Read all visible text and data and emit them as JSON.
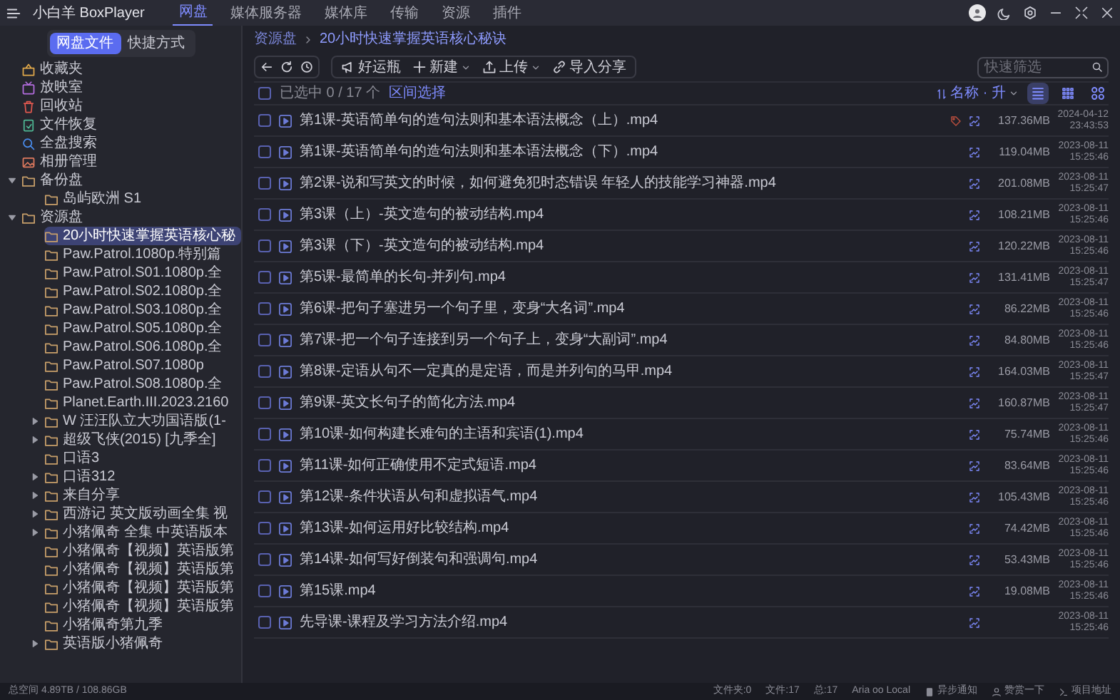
{
  "app": {
    "title": "小白羊 BoxPlayer"
  },
  "nav_tabs": [
    {
      "label": "网盘",
      "selected": true
    },
    {
      "label": "媒体服务器",
      "selected": false
    },
    {
      "label": "媒体库",
      "selected": false
    },
    {
      "label": "传输",
      "selected": false
    },
    {
      "label": "资源",
      "selected": false
    },
    {
      "label": "插件",
      "selected": false
    }
  ],
  "sidebar": {
    "tabs": [
      {
        "label": "网盘文件",
        "selected": true
      },
      {
        "label": "快捷方式",
        "selected": false
      }
    ],
    "tree": [
      {
        "label": "收藏夹",
        "kind": "favorites",
        "selected": false
      },
      {
        "label": "放映室",
        "kind": "screening",
        "selected": false
      },
      {
        "label": "回收站",
        "kind": "trash",
        "selected": false
      },
      {
        "label": "文件恢复",
        "kind": "recover",
        "selected": false
      },
      {
        "label": "全盘搜索",
        "kind": "search",
        "selected": false
      },
      {
        "label": "相册管理",
        "kind": "album",
        "selected": false
      },
      {
        "label": "备份盘",
        "kind": "folder",
        "expanded": true,
        "selected": false,
        "children": [
          {
            "label": "岛屿欧洲 S1",
            "kind": "folder",
            "selected": false
          }
        ]
      },
      {
        "label": "资源盘",
        "kind": "folder",
        "expanded": true,
        "selected": false,
        "children": [
          {
            "label": "20小时快速掌握英语核心秘",
            "kind": "folder",
            "selected": true
          },
          {
            "label": "Paw.Patrol.1080p.特别篇",
            "kind": "folder",
            "selected": false
          },
          {
            "label": "Paw.Patrol.S01.1080p.全",
            "kind": "folder",
            "selected": false
          },
          {
            "label": "Paw.Patrol.S02.1080p.全",
            "kind": "folder",
            "selected": false
          },
          {
            "label": "Paw.Patrol.S03.1080p.全",
            "kind": "folder",
            "selected": false
          },
          {
            "label": "Paw.Patrol.S05.1080p.全",
            "kind": "folder",
            "selected": false
          },
          {
            "label": "Paw.Patrol.S06.1080p.全",
            "kind": "folder",
            "selected": false
          },
          {
            "label": "Paw.Patrol.S07.1080p",
            "kind": "folder",
            "selected": false
          },
          {
            "label": "Paw.Patrol.S08.1080p.全",
            "kind": "folder",
            "selected": false
          },
          {
            "label": "Planet.Earth.III.2023.2160",
            "kind": "folder",
            "selected": false
          },
          {
            "label": "W 汪汪队立大功国语版(1-",
            "kind": "folder",
            "expanded": false,
            "selected": false
          },
          {
            "label": "超级飞侠(2015) [九季全]",
            "kind": "folder",
            "expanded": false,
            "selected": false
          },
          {
            "label": "口语3",
            "kind": "folder",
            "selected": false
          },
          {
            "label": "口语312",
            "kind": "folder",
            "expanded": false,
            "selected": false
          },
          {
            "label": "来自分享",
            "kind": "folder",
            "expanded": false,
            "selected": false
          },
          {
            "label": "西游记 英文版动画全集 视",
            "kind": "folder",
            "expanded": false,
            "selected": false
          },
          {
            "label": "小猪佩奇 全集 中英语版本",
            "kind": "folder",
            "expanded": false,
            "selected": false
          },
          {
            "label": "小猪佩奇【视频】英语版第",
            "kind": "folder",
            "selected": false
          },
          {
            "label": "小猪佩奇【视频】英语版第",
            "kind": "folder",
            "selected": false
          },
          {
            "label": "小猪佩奇【视频】英语版第",
            "kind": "folder",
            "selected": false
          },
          {
            "label": "小猪佩奇【视频】英语版第",
            "kind": "folder",
            "selected": false
          },
          {
            "label": "小猪佩奇第九季",
            "kind": "folder",
            "selected": false
          },
          {
            "label": "英语版小猪佩奇",
            "kind": "folder",
            "expanded": false,
            "selected": false
          }
        ]
      }
    ]
  },
  "breadcrumb": [
    "资源盘",
    "20小时快速掌握英语核心秘诀"
  ],
  "toolbar": {
    "buttons": [
      {
        "label": "好运瓶",
        "kind": "bottle",
        "dropdown": false
      },
      {
        "label": "新建",
        "kind": "new",
        "dropdown": true
      },
      {
        "label": "上传",
        "kind": "upload",
        "dropdown": true
      },
      {
        "label": "导入分享",
        "kind": "link",
        "dropdown": false
      }
    ],
    "search": {
      "placeholder": "快速筛选"
    }
  },
  "selection": {
    "checked": false,
    "text": "已选中 0 / 17 个",
    "link": "区间选择"
  },
  "sort": {
    "label": "名称 · 升"
  },
  "views": [
    {
      "kind": "list",
      "selected": true
    },
    {
      "kind": "grid",
      "selected": false
    },
    {
      "kind": "gallery",
      "selected": false
    }
  ],
  "files": [
    {
      "name": "第1课-英语简单句的造句法则和基本语法概念（上）.mp4",
      "checked": false,
      "tagged": true,
      "size": "137.36MB",
      "date": "2024-04-12",
      "time": "23:43:53"
    },
    {
      "name": "第1课-英语简单句的造句法则和基本语法概念（下）.mp4",
      "checked": false,
      "tagged": false,
      "size": "119.04MB",
      "date": "2023-08-11",
      "time": "15:25:46"
    },
    {
      "name": "第2课-说和写英文的时候，如何避免犯时态错误  年轻人的技能学习神器.mp4",
      "checked": false,
      "tagged": false,
      "size": "201.08MB",
      "date": "2023-08-11",
      "time": "15:25:47"
    },
    {
      "name": "第3课（上）-英文造句的被动结构.mp4",
      "checked": false,
      "tagged": false,
      "size": "108.21MB",
      "date": "2023-08-11",
      "time": "15:25:46"
    },
    {
      "name": "第3课（下）-英文造句的被动结构.mp4",
      "checked": false,
      "tagged": false,
      "size": "120.22MB",
      "date": "2023-08-11",
      "time": "15:25:46"
    },
    {
      "name": "第5课-最简单的长句-并列句.mp4",
      "checked": false,
      "tagged": false,
      "size": "131.41MB",
      "date": "2023-08-11",
      "time": "15:25:47"
    },
    {
      "name": "第6课-把句子塞进另一个句子里，变身“大名词”.mp4",
      "checked": false,
      "tagged": false,
      "size": "86.22MB",
      "date": "2023-08-11",
      "time": "15:25:46"
    },
    {
      "name": "第7课-把一个句子连接到另一个句子上，变身“大副词”.mp4",
      "checked": false,
      "tagged": false,
      "size": "84.80MB",
      "date": "2023-08-11",
      "time": "15:25:46"
    },
    {
      "name": "第8课-定语从句不一定真的是定语，而是并列句的马甲.mp4",
      "checked": false,
      "tagged": false,
      "size": "164.03MB",
      "date": "2023-08-11",
      "time": "15:25:47"
    },
    {
      "name": "第9课-英文长句子的简化方法.mp4",
      "checked": false,
      "tagged": false,
      "size": "160.87MB",
      "date": "2023-08-11",
      "time": "15:25:47"
    },
    {
      "name": "第10课-如何构建长难句的主语和宾语(1).mp4",
      "checked": false,
      "tagged": false,
      "size": "75.74MB",
      "date": "2023-08-11",
      "time": "15:25:46"
    },
    {
      "name": "第11课-如何正确使用不定式短语.mp4",
      "checked": false,
      "tagged": false,
      "size": "83.64MB",
      "date": "2023-08-11",
      "time": "15:25:46"
    },
    {
      "name": "第12课-条件状语从句和虚拟语气.mp4",
      "checked": false,
      "tagged": false,
      "size": "105.43MB",
      "date": "2023-08-11",
      "time": "15:25:46"
    },
    {
      "name": "第13课-如何运用好比较结构.mp4",
      "checked": false,
      "tagged": false,
      "size": "74.42MB",
      "date": "2023-08-11",
      "time": "15:25:46"
    },
    {
      "name": "第14课-如何写好倒装句和强调句.mp4",
      "checked": false,
      "tagged": false,
      "size": "53.43MB",
      "date": "2023-08-11",
      "time": "15:25:46"
    },
    {
      "name": "第15课.mp4",
      "checked": false,
      "tagged": false,
      "size": "19.08MB",
      "date": "2023-08-11",
      "time": "15:25:46"
    },
    {
      "name": "先导课-课程及学习方法介绍.mp4",
      "checked": false,
      "tagged": false,
      "date": "2023-08-11",
      "time": "15:25:46"
    }
  ],
  "status_bar": {
    "left": "总空间 4.89TB / 108.86GB",
    "items": [
      {
        "label": "文件夹:0",
        "kind": "text"
      },
      {
        "label": "文件:17",
        "kind": "text"
      },
      {
        "label": "总:17",
        "kind": "text"
      },
      {
        "label": "Aria oo Local",
        "kind": "text"
      },
      {
        "label": "异步通知",
        "kind": "notify"
      },
      {
        "label": "赞赏一下",
        "kind": "donate"
      },
      {
        "label": "项目地址",
        "kind": "link"
      }
    ]
  }
}
